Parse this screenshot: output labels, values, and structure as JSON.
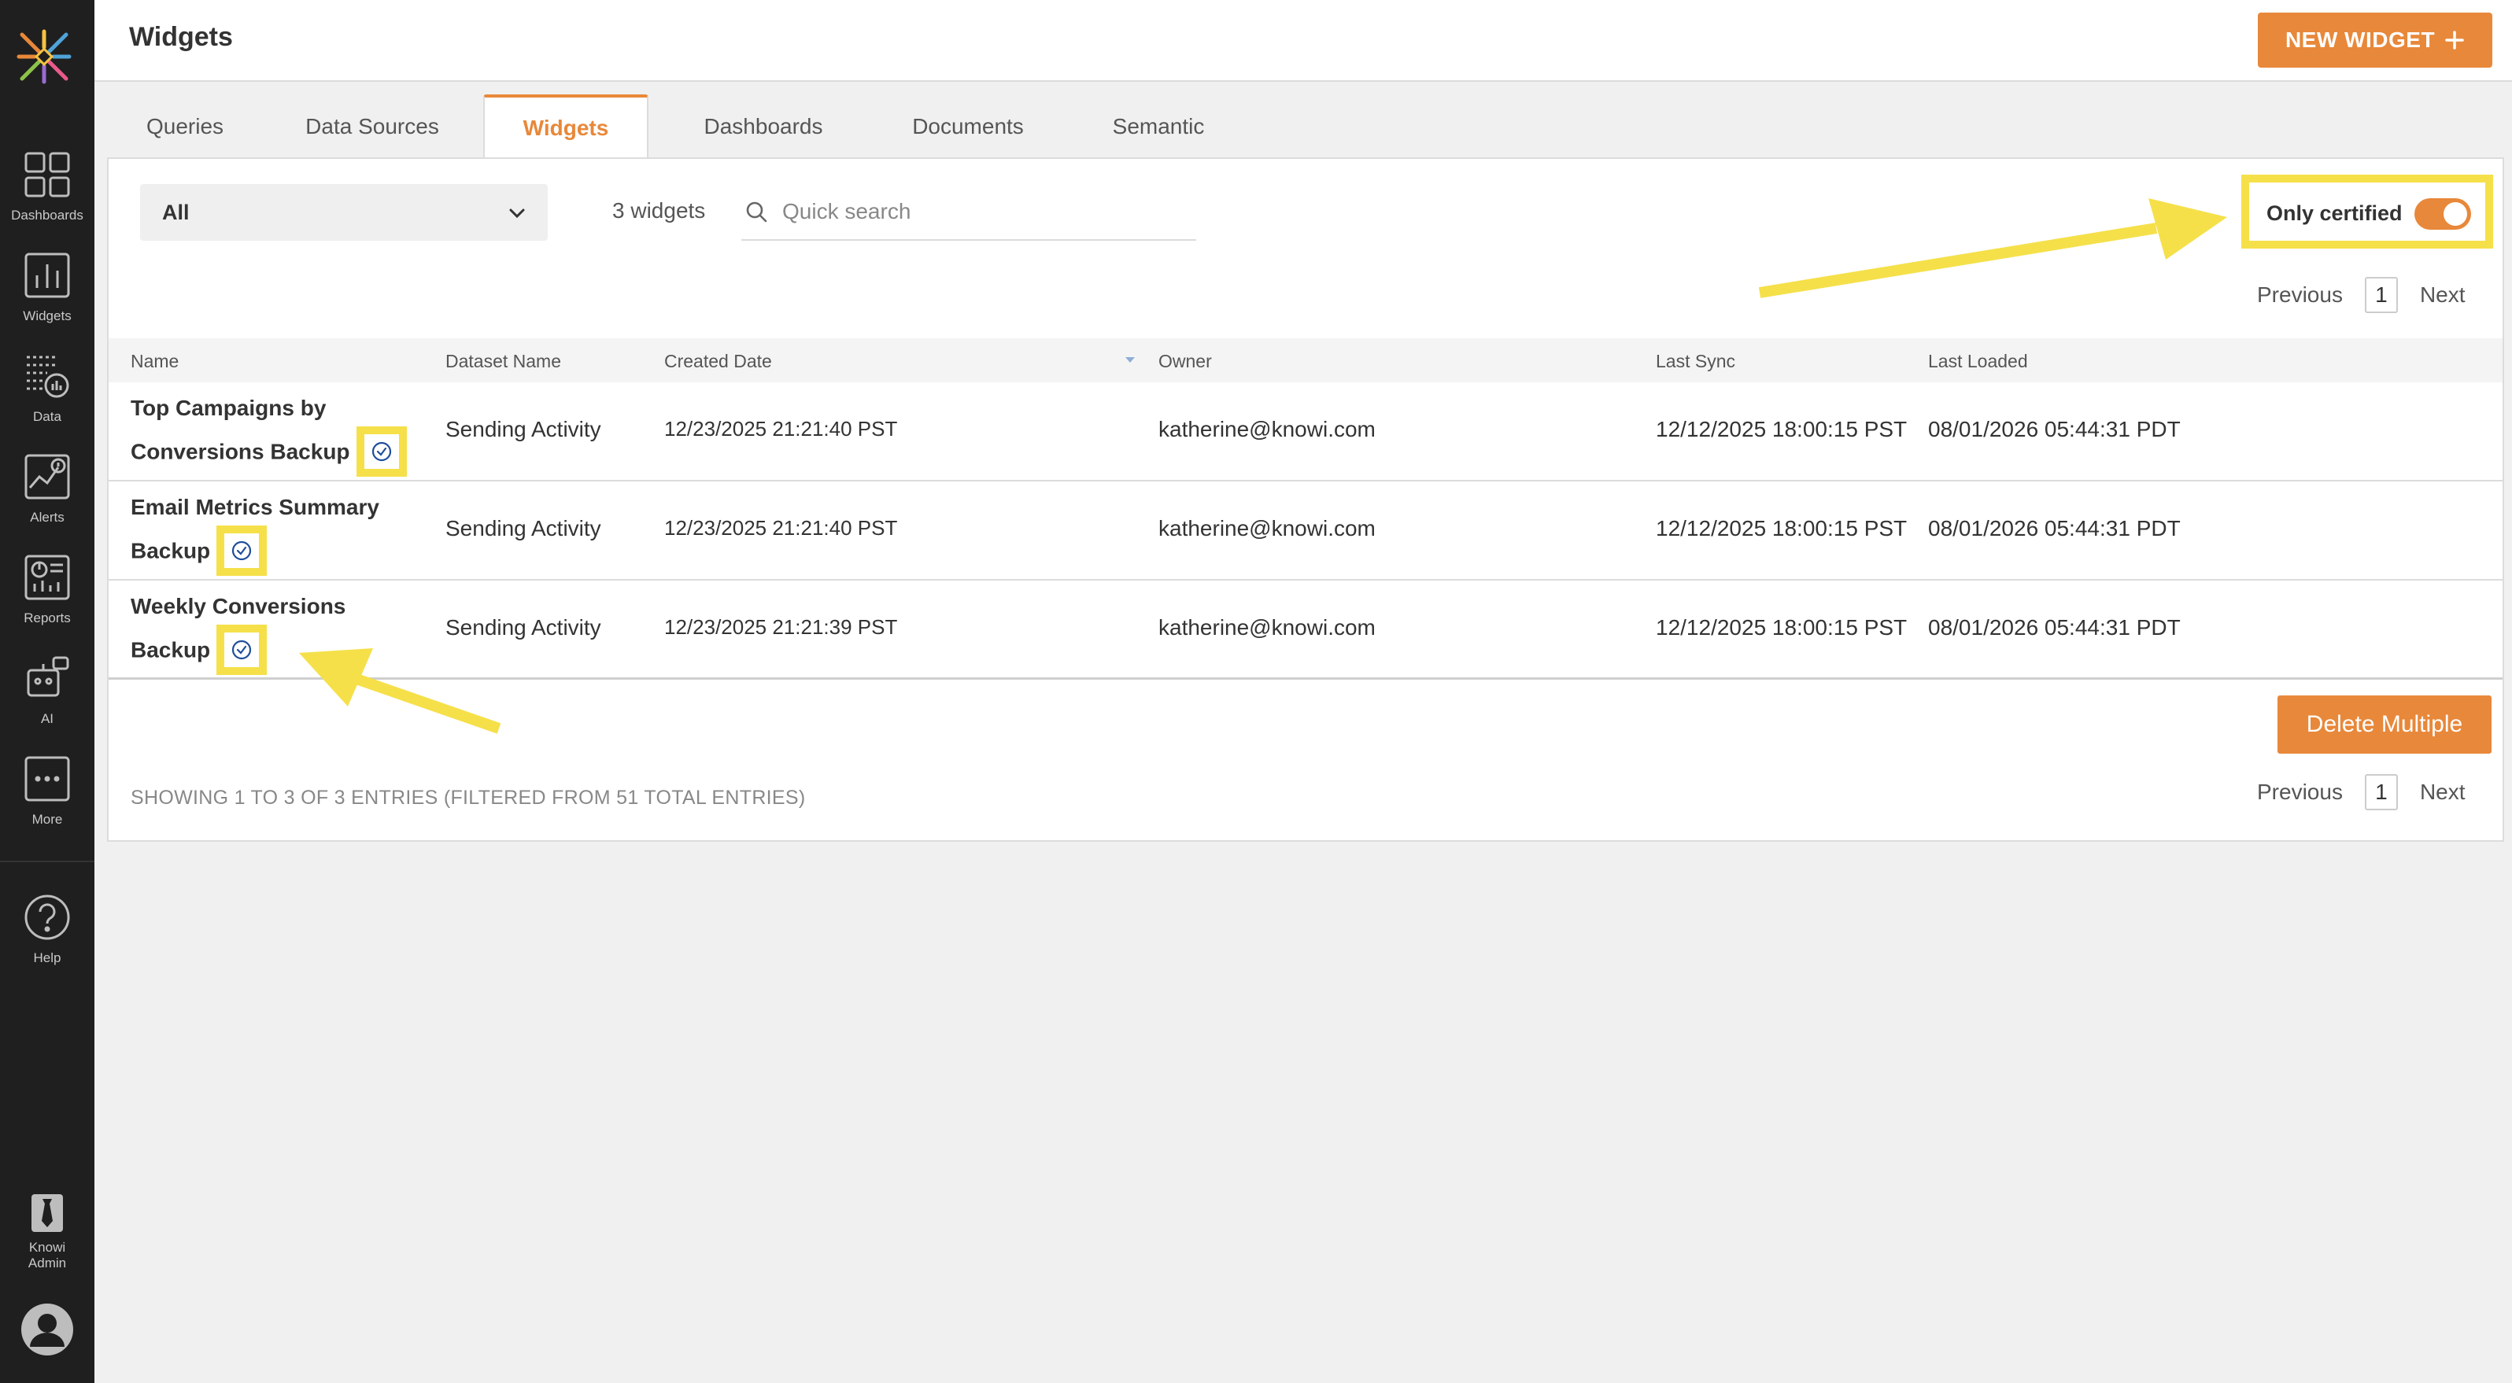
{
  "app": {
    "page_title": "Widgets",
    "new_widget_label": "NEW WIDGET"
  },
  "sidebar": {
    "items": [
      {
        "label": "Dashboards",
        "icon": "dashboards-grid-icon"
      },
      {
        "label": "Widgets",
        "icon": "bar-chart-icon"
      },
      {
        "label": "Data",
        "icon": "data-icon"
      },
      {
        "label": "Alerts",
        "icon": "alerts-icon"
      },
      {
        "label": "Reports",
        "icon": "reports-icon"
      },
      {
        "label": "AI",
        "icon": "ai-robot-icon"
      },
      {
        "label": "More",
        "icon": "more-dots-icon"
      },
      {
        "label": "Help",
        "icon": "help-icon"
      }
    ],
    "admin_label_line1": "Knowi",
    "admin_label_line2": "Admin"
  },
  "tabs": [
    {
      "label": "Queries",
      "active": false
    },
    {
      "label": "Data Sources",
      "active": false
    },
    {
      "label": "Widgets",
      "active": true
    },
    {
      "label": "Dashboards",
      "active": false
    },
    {
      "label": "Documents",
      "active": false
    },
    {
      "label": "Semantic",
      "active": false
    }
  ],
  "filters": {
    "select_value": "All",
    "widget_count": "3 widgets",
    "search_placeholder": "Quick search",
    "certified_label": "Only certified",
    "certified_on": true
  },
  "pagination": {
    "previous": "Previous",
    "page": "1",
    "next": "Next"
  },
  "table": {
    "columns": [
      "Name",
      "Dataset Name",
      "Created Date",
      "Owner",
      "Last Sync",
      "Last Loaded"
    ],
    "rows": [
      {
        "name_line1": "Top Campaigns by",
        "name_line2": "Conversions Backup",
        "dataset": "Sending Activity",
        "created": "12/23/2025 21:21:40 PST",
        "owner": "katherine@knowi.com",
        "last_sync": "12/12/2025 18:00:15 PST",
        "last_loaded": "08/01/2026 05:44:31 PDT"
      },
      {
        "name_line1": "Email Metrics Summary",
        "name_line2": "Backup",
        "dataset": "Sending Activity",
        "created": "12/23/2025 21:21:40 PST",
        "owner": "katherine@knowi.com",
        "last_sync": "12/12/2025 18:00:15 PST",
        "last_loaded": "08/01/2026 05:44:31 PDT"
      },
      {
        "name_line1": "Weekly Conversions",
        "name_line2": "Backup",
        "dataset": "Sending Activity",
        "created": "12/23/2025 21:21:39 PST",
        "owner": "katherine@knowi.com",
        "last_sync": "12/12/2025 18:00:15 PST",
        "last_loaded": "08/01/2026 05:44:31 PDT"
      }
    ]
  },
  "footer": {
    "delete_multiple": "Delete Multiple",
    "entries_text": "SHOWING 1 TO 3 OF 3 ENTRIES (FILTERED FROM 51 TOTAL ENTRIES)"
  },
  "colors": {
    "accent": "#e8883a",
    "sidebar_bg": "#1f1f1f",
    "annotation_yellow": "#f5e04a",
    "certified_icon": "#1f4e9c"
  }
}
